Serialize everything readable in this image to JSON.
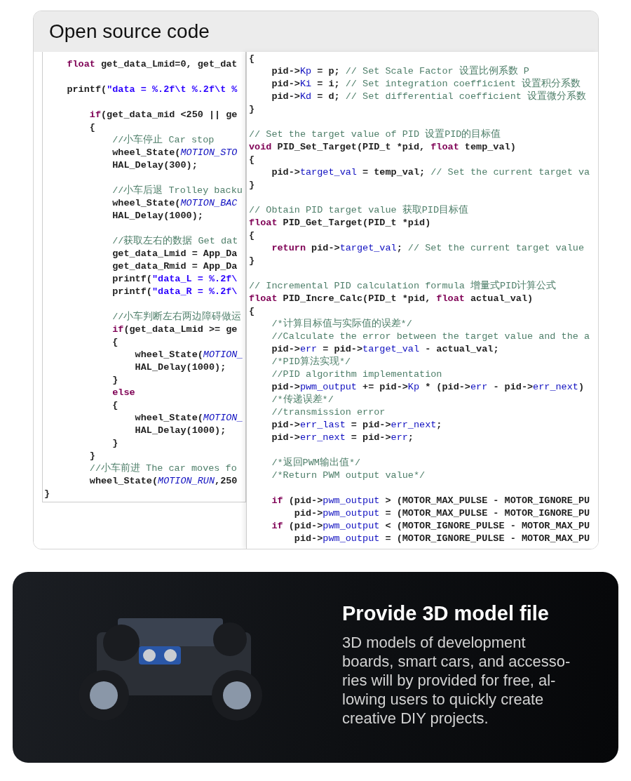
{
  "code_section": {
    "title": "Open source code",
    "left_panel": {
      "lines": [
        {
          "kind": "code",
          "parts": [
            {
              "kind": "kw",
              "text": "    float"
            },
            {
              "kind": "tx",
              "text": " get_data_Lmid=0, get_dat"
            }
          ]
        },
        {
          "kind": "blank"
        },
        {
          "kind": "code",
          "parts": [
            {
              "kind": "tx",
              "text": "    printf("
            },
            {
              "kind": "str",
              "text": "\"data = %.2f\\t %.2f\\t %"
            }
          ]
        },
        {
          "kind": "blank"
        },
        {
          "kind": "code",
          "parts": [
            {
              "kind": "kw",
              "text": "        if"
            },
            {
              "kind": "tx",
              "text": "(get_data_mid <250 || ge"
            }
          ]
        },
        {
          "kind": "code",
          "parts": [
            {
              "kind": "tx",
              "text": "        {"
            }
          ]
        },
        {
          "kind": "code",
          "parts": [
            {
              "kind": "cm",
              "text": "            //小车停止 Car stop"
            }
          ]
        },
        {
          "kind": "code",
          "parts": [
            {
              "kind": "tx",
              "text": "            wheel_State("
            },
            {
              "kind": "mc",
              "text": "MOTION_STO"
            }
          ]
        },
        {
          "kind": "code",
          "parts": [
            {
              "kind": "tx",
              "text": "            HAL_Delay(300);"
            }
          ]
        },
        {
          "kind": "blank"
        },
        {
          "kind": "code",
          "parts": [
            {
              "kind": "cm",
              "text": "            //小车后退 Trolley backu"
            }
          ]
        },
        {
          "kind": "code",
          "parts": [
            {
              "kind": "tx",
              "text": "            wheel_State("
            },
            {
              "kind": "mc",
              "text": "MOTION_BAC"
            }
          ]
        },
        {
          "kind": "code",
          "parts": [
            {
              "kind": "tx",
              "text": "            HAL_Delay(1000);"
            }
          ]
        },
        {
          "kind": "blank"
        },
        {
          "kind": "code",
          "parts": [
            {
              "kind": "cm",
              "text": "            //获取左右的数据 Get dat"
            }
          ]
        },
        {
          "kind": "code",
          "parts": [
            {
              "kind": "tx",
              "text": "            get_data_Lmid = App_Da"
            }
          ]
        },
        {
          "kind": "code",
          "parts": [
            {
              "kind": "tx",
              "text": "            get_data_Rmid = App_Da"
            }
          ]
        },
        {
          "kind": "code",
          "parts": [
            {
              "kind": "tx",
              "text": "            printf("
            },
            {
              "kind": "str",
              "text": "\"data_L = %.2f\\"
            }
          ]
        },
        {
          "kind": "code",
          "parts": [
            {
              "kind": "tx",
              "text": "            printf("
            },
            {
              "kind": "str",
              "text": "\"data_R = %.2f\\"
            }
          ]
        },
        {
          "kind": "blank"
        },
        {
          "kind": "code",
          "parts": [
            {
              "kind": "cm",
              "text": "            //小车判断左右两边障碍做运"
            }
          ]
        },
        {
          "kind": "code",
          "parts": [
            {
              "kind": "kw",
              "text": "            if"
            },
            {
              "kind": "tx",
              "text": "(get_data_Lmid >= ge"
            }
          ]
        },
        {
          "kind": "code",
          "parts": [
            {
              "kind": "tx",
              "text": "            {"
            }
          ]
        },
        {
          "kind": "code",
          "parts": [
            {
              "kind": "tx",
              "text": "                wheel_State("
            },
            {
              "kind": "mc",
              "text": "MOTION_"
            }
          ]
        },
        {
          "kind": "code",
          "parts": [
            {
              "kind": "tx",
              "text": "                HAL_Delay(1000);"
            }
          ]
        },
        {
          "kind": "code",
          "parts": [
            {
              "kind": "tx",
              "text": "            }"
            }
          ]
        },
        {
          "kind": "code",
          "parts": [
            {
              "kind": "kw",
              "text": "            else"
            }
          ]
        },
        {
          "kind": "code",
          "parts": [
            {
              "kind": "tx",
              "text": "            {"
            }
          ]
        },
        {
          "kind": "code",
          "parts": [
            {
              "kind": "tx",
              "text": "                wheel_State("
            },
            {
              "kind": "mc",
              "text": "MOTION_"
            }
          ]
        },
        {
          "kind": "code",
          "parts": [
            {
              "kind": "tx",
              "text": "                HAL_Delay(1000);"
            }
          ]
        },
        {
          "kind": "code",
          "parts": [
            {
              "kind": "tx",
              "text": "            }"
            }
          ]
        },
        {
          "kind": "code",
          "parts": [
            {
              "kind": "tx",
              "text": "        }"
            }
          ]
        },
        {
          "kind": "code",
          "parts": [
            {
              "kind": "cm",
              "text": "        //小车前进 The car moves fo"
            }
          ]
        },
        {
          "kind": "code",
          "parts": [
            {
              "kind": "tx",
              "text": "        wheel_State("
            },
            {
              "kind": "mc",
              "text": "MOTION_RUN"
            },
            {
              "kind": "tx",
              "text": ",250"
            }
          ]
        },
        {
          "kind": "code",
          "parts": [
            {
              "kind": "tx",
              "text": "}"
            }
          ]
        }
      ]
    },
    "right_panel": {
      "lines": [
        {
          "kind": "code",
          "parts": [
            {
              "kind": "tx",
              "text": "{"
            }
          ]
        },
        {
          "kind": "code",
          "parts": [
            {
              "kind": "tx",
              "text": "    pid->"
            },
            {
              "kind": "mb",
              "text": "Kp"
            },
            {
              "kind": "tx",
              "text": " = p; "
            },
            {
              "kind": "cm",
              "text": "// Set Scale Factor 设置比例系数 P"
            }
          ]
        },
        {
          "kind": "code",
          "parts": [
            {
              "kind": "tx",
              "text": "    pid->"
            },
            {
              "kind": "mb",
              "text": "Ki"
            },
            {
              "kind": "tx",
              "text": " = i; "
            },
            {
              "kind": "cm",
              "text": "// Set integration coefficient 设置积分系数"
            }
          ]
        },
        {
          "kind": "code",
          "parts": [
            {
              "kind": "tx",
              "text": "    pid->"
            },
            {
              "kind": "mb",
              "text": "Kd"
            },
            {
              "kind": "tx",
              "text": " = d; "
            },
            {
              "kind": "cm",
              "text": "// Set differential coefficient 设置微分系数"
            }
          ]
        },
        {
          "kind": "code",
          "parts": [
            {
              "kind": "tx",
              "text": "}"
            }
          ]
        },
        {
          "kind": "blank"
        },
        {
          "kind": "code",
          "parts": [
            {
              "kind": "cm",
              "text": "// Set the target value of PID 设置PID的目标值"
            }
          ]
        },
        {
          "kind": "code",
          "parts": [
            {
              "kind": "kw",
              "text": "void"
            },
            {
              "kind": "tx",
              "text": " PID_Set_Target(PID_t *pid, "
            },
            {
              "kind": "kw",
              "text": "float"
            },
            {
              "kind": "tx",
              "text": " temp_val)"
            }
          ]
        },
        {
          "kind": "code",
          "parts": [
            {
              "kind": "tx",
              "text": "{"
            }
          ]
        },
        {
          "kind": "code",
          "parts": [
            {
              "kind": "tx",
              "text": "    pid->"
            },
            {
              "kind": "mb",
              "text": "target_val"
            },
            {
              "kind": "tx",
              "text": " = temp_val; "
            },
            {
              "kind": "cm",
              "text": "// Set the current target va"
            }
          ]
        },
        {
          "kind": "code",
          "parts": [
            {
              "kind": "tx",
              "text": "}"
            }
          ]
        },
        {
          "kind": "blank"
        },
        {
          "kind": "code",
          "parts": [
            {
              "kind": "cm",
              "text": "// Obtain PID target value 获取PID目标值"
            }
          ]
        },
        {
          "kind": "code",
          "parts": [
            {
              "kind": "kw",
              "text": "float"
            },
            {
              "kind": "tx",
              "text": " PID_Get_Target(PID_t *pid)"
            }
          ]
        },
        {
          "kind": "code",
          "parts": [
            {
              "kind": "tx",
              "text": "{"
            }
          ]
        },
        {
          "kind": "code",
          "parts": [
            {
              "kind": "kw",
              "text": "    return"
            },
            {
              "kind": "tx",
              "text": " pid->"
            },
            {
              "kind": "mb",
              "text": "target_val"
            },
            {
              "kind": "tx",
              "text": "; "
            },
            {
              "kind": "cm",
              "text": "// Set the current target value"
            }
          ]
        },
        {
          "kind": "code",
          "parts": [
            {
              "kind": "tx",
              "text": "}"
            }
          ]
        },
        {
          "kind": "blank"
        },
        {
          "kind": "code",
          "parts": [
            {
              "kind": "cm",
              "text": "// Incremental PID calculation formula 增量式PID计算公式"
            }
          ]
        },
        {
          "kind": "code",
          "parts": [
            {
              "kind": "kw",
              "text": "float"
            },
            {
              "kind": "tx",
              "text": " PID_Incre_Calc(PID_t *pid, "
            },
            {
              "kind": "kw",
              "text": "float"
            },
            {
              "kind": "tx",
              "text": " actual_val)"
            }
          ]
        },
        {
          "kind": "code",
          "parts": [
            {
              "kind": "tx",
              "text": "{"
            }
          ]
        },
        {
          "kind": "code",
          "parts": [
            {
              "kind": "cm",
              "text": "    /*计算目标值与实际值的误差*/"
            }
          ]
        },
        {
          "kind": "code",
          "parts": [
            {
              "kind": "cm",
              "text": "    //Calculate the error between the target value and the a"
            }
          ]
        },
        {
          "kind": "code",
          "parts": [
            {
              "kind": "tx",
              "text": "    pid->"
            },
            {
              "kind": "mb",
              "text": "err"
            },
            {
              "kind": "tx",
              "text": " = pid->"
            },
            {
              "kind": "mb",
              "text": "target_val"
            },
            {
              "kind": "tx",
              "text": " - actual_val;"
            }
          ]
        },
        {
          "kind": "code",
          "parts": [
            {
              "kind": "cm",
              "text": "    /*PID算法实现*/"
            }
          ]
        },
        {
          "kind": "code",
          "parts": [
            {
              "kind": "cm",
              "text": "    //PID algorithm implementation"
            }
          ]
        },
        {
          "kind": "code",
          "parts": [
            {
              "kind": "tx",
              "text": "    pid->"
            },
            {
              "kind": "mb",
              "text": "pwm_output"
            },
            {
              "kind": "tx",
              "text": " += pid->"
            },
            {
              "kind": "mb",
              "text": "Kp"
            },
            {
              "kind": "tx",
              "text": " * (pid->"
            },
            {
              "kind": "mb",
              "text": "err"
            },
            {
              "kind": "tx",
              "text": " - pid->"
            },
            {
              "kind": "mb",
              "text": "err_next"
            },
            {
              "kind": "tx",
              "text": ")"
            }
          ]
        },
        {
          "kind": "code",
          "parts": [
            {
              "kind": "cm",
              "text": "    /*传递误差*/"
            }
          ]
        },
        {
          "kind": "code",
          "parts": [
            {
              "kind": "cm",
              "text": "    //transmission error"
            }
          ]
        },
        {
          "kind": "code",
          "parts": [
            {
              "kind": "tx",
              "text": "    pid->"
            },
            {
              "kind": "mb",
              "text": "err_last"
            },
            {
              "kind": "tx",
              "text": " = pid->"
            },
            {
              "kind": "mb",
              "text": "err_next"
            },
            {
              "kind": "tx",
              "text": ";"
            }
          ]
        },
        {
          "kind": "code",
          "parts": [
            {
              "kind": "tx",
              "text": "    pid->"
            },
            {
              "kind": "mb",
              "text": "err_next"
            },
            {
              "kind": "tx",
              "text": " = pid->"
            },
            {
              "kind": "mb",
              "text": "err"
            },
            {
              "kind": "tx",
              "text": ";"
            }
          ]
        },
        {
          "kind": "blank"
        },
        {
          "kind": "code",
          "parts": [
            {
              "kind": "cm",
              "text": "    /*返回PWM输出值*/"
            }
          ]
        },
        {
          "kind": "code",
          "parts": [
            {
              "kind": "cm",
              "text": "    /*Return PWM output value*/"
            }
          ]
        },
        {
          "kind": "blank"
        },
        {
          "kind": "code",
          "parts": [
            {
              "kind": "kw",
              "text": "    if"
            },
            {
              "kind": "tx",
              "text": " (pid->"
            },
            {
              "kind": "mb",
              "text": "pwm_output"
            },
            {
              "kind": "tx",
              "text": " > (MOTOR_MAX_PULSE - MOTOR_IGNORE_PU"
            }
          ]
        },
        {
          "kind": "code",
          "parts": [
            {
              "kind": "tx",
              "text": "        pid->"
            },
            {
              "kind": "mb",
              "text": "pwm_output"
            },
            {
              "kind": "tx",
              "text": " = (MOTOR_MAX_PULSE - MOTOR_IGNORE_PU"
            }
          ]
        },
        {
          "kind": "code",
          "parts": [
            {
              "kind": "kw",
              "text": "    if"
            },
            {
              "kind": "tx",
              "text": " (pid->"
            },
            {
              "kind": "mb",
              "text": "pwm_output"
            },
            {
              "kind": "tx",
              "text": " < (MOTOR_IGNORE_PULSE - MOTOR_MAX_PU"
            }
          ]
        },
        {
          "kind": "code",
          "parts": [
            {
              "kind": "tx",
              "text": "        pid->"
            },
            {
              "kind": "mb",
              "text": "pwm_output"
            },
            {
              "kind": "tx",
              "text": " = (MOTOR_IGNORE_PULSE - MOTOR_MAX_PU"
            }
          ]
        }
      ]
    }
  },
  "model_section": {
    "title": "Provide 3D model file",
    "body_lines": [
      "3D models of development",
      "boards, smart cars, and accesso-",
      "ries will by provided for free, al-",
      "lowing users to quickly create",
      "creative DIY projects."
    ]
  }
}
